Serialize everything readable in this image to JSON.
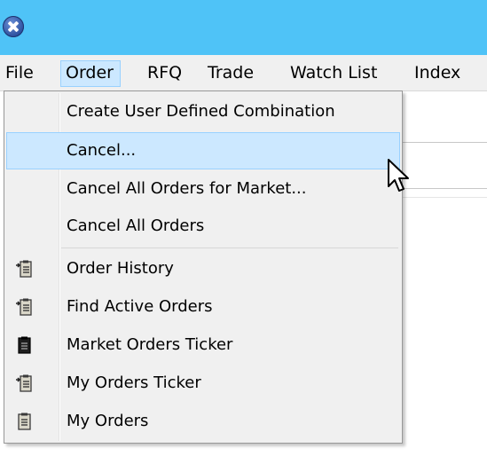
{
  "titlebar": {
    "bg_color": "#4fc3f7",
    "icon": "app-close-icon"
  },
  "menubar": {
    "items": [
      {
        "label": "File"
      },
      {
        "label": "Order",
        "state": "open"
      },
      {
        "label": "RFQ"
      },
      {
        "label": "Trade"
      },
      {
        "label": "Watch List"
      },
      {
        "label": "Index"
      }
    ]
  },
  "dropdown": {
    "highlight_color": "#cce8ff",
    "items": [
      {
        "label": "Create User Defined Combination"
      },
      {
        "label": "Cancel...",
        "state": "hover"
      },
      {
        "label": "Cancel All Orders for Market..."
      },
      {
        "label": "Cancel All Orders"
      },
      {
        "label": "Order History",
        "icon": "order-history-icon"
      },
      {
        "label": "Find Active Orders",
        "icon": "find-active-orders-icon"
      },
      {
        "label": "Market Orders Ticker",
        "icon": "market-orders-ticker-icon"
      },
      {
        "label": "My Orders Ticker",
        "icon": "my-orders-ticker-icon"
      },
      {
        "label": "My Orders",
        "icon": "my-orders-icon"
      }
    ]
  },
  "cursor": {
    "icon": "mouse-pointer-icon"
  }
}
